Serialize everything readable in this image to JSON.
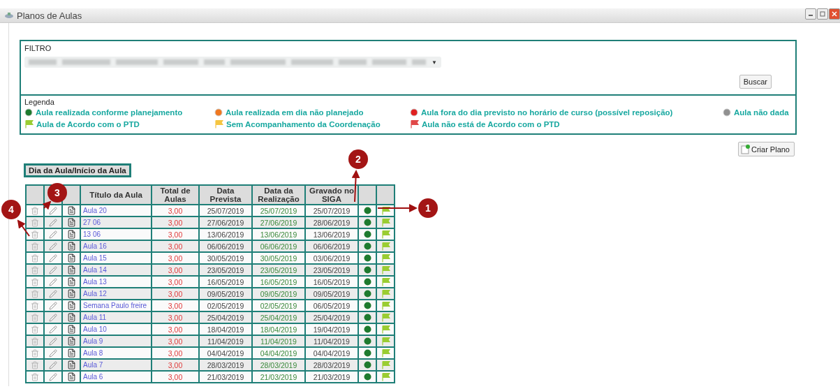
{
  "window": {
    "title": "Planos de Aulas"
  },
  "filter": {
    "label": "FILTRO",
    "caret": "▼",
    "search_button": "Buscar"
  },
  "legend": {
    "title": "Legenda",
    "items": [
      {
        "kind": "dot",
        "color": "#1e7a2e",
        "label": "Aula realizada conforme planejamento"
      },
      {
        "kind": "dot",
        "color": "#f07820",
        "label": "Aula realizada em dia não planejado"
      },
      {
        "kind": "dot",
        "color": "#e02020",
        "label": "Aula fora do dia previsto no horário de curso (possível reposição)"
      },
      {
        "kind": "dot",
        "color": "#909090",
        "label": "Aula não dada"
      },
      {
        "kind": "flag",
        "color": "#9acd32",
        "label": "Aula de Acordo com o PTD"
      },
      {
        "kind": "flag",
        "color": "#f5c542",
        "label": "Sem Acompanhamento da Coordenação"
      },
      {
        "kind": "flag",
        "color": "#e04848",
        "label": "Aula não está de Acordo com o PTD"
      }
    ]
  },
  "create_button": "Criar Plano",
  "sort_tab": "Dia da Aula/Início da Aula",
  "table": {
    "columns": [
      "Título da Aula",
      "Total de Aulas",
      "Data Prevista",
      "Data da Realização",
      "Gravado no SIGA"
    ],
    "rows": [
      {
        "title": "Aula 20",
        "total": "3,00",
        "planned": "25/07/2019",
        "done": "25/07/2019",
        "recorded": "25/07/2019",
        "status": {
          "color": "#1e7a2e"
        },
        "flag": {
          "color": "#9acd32"
        }
      },
      {
        "title": "27 06",
        "total": "3,00",
        "planned": "27/06/2019",
        "done": "27/06/2019",
        "recorded": "28/06/2019",
        "status": {
          "color": "#1e7a2e"
        },
        "flag": {
          "color": "#9acd32"
        }
      },
      {
        "title": "13 06",
        "total": "3,00",
        "planned": "13/06/2019",
        "done": "13/06/2019",
        "recorded": "13/06/2019",
        "status": {
          "color": "#1e7a2e"
        },
        "flag": {
          "color": "#9acd32"
        }
      },
      {
        "title": "Aula 16",
        "total": "3,00",
        "planned": "06/06/2019",
        "done": "06/06/2019",
        "recorded": "06/06/2019",
        "status": {
          "color": "#1e7a2e"
        },
        "flag": {
          "color": "#9acd32"
        }
      },
      {
        "title": "Aula 15",
        "total": "3,00",
        "planned": "30/05/2019",
        "done": "30/05/2019",
        "recorded": "03/06/2019",
        "status": {
          "color": "#1e7a2e"
        },
        "flag": {
          "color": "#9acd32"
        }
      },
      {
        "title": "Aula 14",
        "total": "3,00",
        "planned": "23/05/2019",
        "done": "23/05/2019",
        "recorded": "23/05/2019",
        "status": {
          "color": "#1e7a2e"
        },
        "flag": {
          "color": "#9acd32"
        }
      },
      {
        "title": "Aula 13",
        "total": "3,00",
        "planned": "16/05/2019",
        "done": "16/05/2019",
        "recorded": "16/05/2019",
        "status": {
          "color": "#1e7a2e"
        },
        "flag": {
          "color": "#9acd32"
        }
      },
      {
        "title": "Aula 12",
        "total": "3,00",
        "planned": "09/05/2019",
        "done": "09/05/2019",
        "recorded": "09/05/2019",
        "status": {
          "color": "#1e7a2e"
        },
        "flag": {
          "color": "#9acd32"
        }
      },
      {
        "title": "Semana Paulo freire",
        "total": "3,00",
        "planned": "02/05/2019",
        "done": "02/05/2019",
        "recorded": "06/05/2019",
        "status": {
          "color": "#1e7a2e"
        },
        "flag": {
          "color": "#9acd32"
        }
      },
      {
        "title": "Aula 11",
        "total": "3,00",
        "planned": "25/04/2019",
        "done": "25/04/2019",
        "recorded": "25/04/2019",
        "status": {
          "color": "#1e7a2e"
        },
        "flag": {
          "color": "#9acd32"
        }
      },
      {
        "title": "Aula 10",
        "total": "3,00",
        "planned": "18/04/2019",
        "done": "18/04/2019",
        "recorded": "19/04/2019",
        "status": {
          "color": "#1e7a2e"
        },
        "flag": {
          "color": "#9acd32"
        }
      },
      {
        "title": "Aula 9",
        "total": "3,00",
        "planned": "11/04/2019",
        "done": "11/04/2019",
        "recorded": "11/04/2019",
        "status": {
          "color": "#1e7a2e"
        },
        "flag": {
          "color": "#9acd32"
        }
      },
      {
        "title": "Aula 8",
        "total": "3,00",
        "planned": "04/04/2019",
        "done": "04/04/2019",
        "recorded": "04/04/2019",
        "status": {
          "color": "#1e7a2e"
        },
        "flag": {
          "color": "#9acd32"
        }
      },
      {
        "title": "Aula 7",
        "total": "3,00",
        "planned": "28/03/2019",
        "done": "28/03/2019",
        "recorded": "28/03/2019",
        "status": {
          "color": "#1e7a2e"
        },
        "flag": {
          "color": "#9acd32"
        }
      },
      {
        "title": "Aula 6",
        "total": "3,00",
        "planned": "21/03/2019",
        "done": "21/03/2019",
        "recorded": "21/03/2019",
        "status": {
          "color": "#1e7a2e"
        },
        "flag": {
          "color": "#9acd32"
        }
      }
    ]
  },
  "callouts": [
    "1",
    "2",
    "3",
    "4"
  ]
}
